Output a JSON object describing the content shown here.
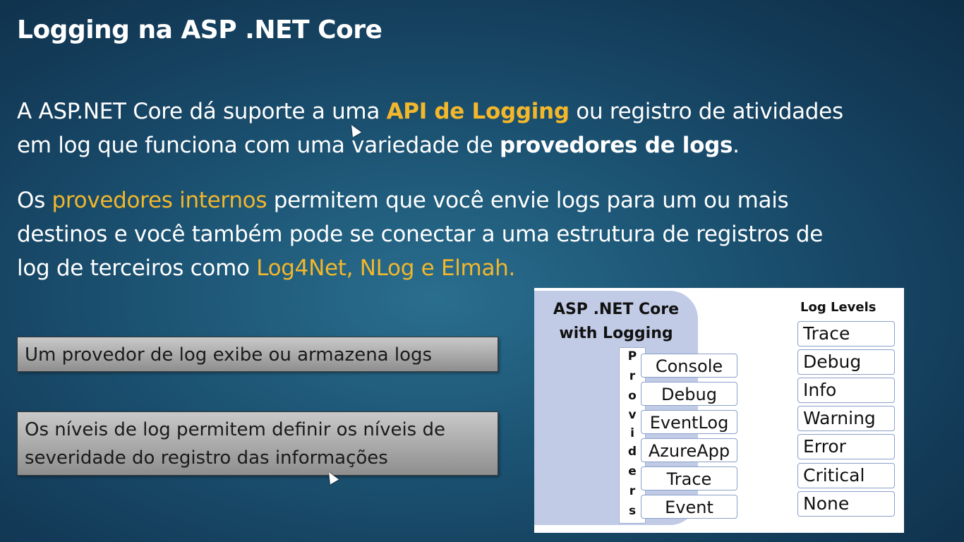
{
  "slide": {
    "title": "Logging na ASP .NET Core",
    "p1": {
      "a": "A ASP.NET Core dá suporte a uma ",
      "b": "API de Logging",
      "c": " ou registro de atividades",
      "d": "em log que funciona com uma variedade de ",
      "e": "provedores de logs",
      "f": "."
    },
    "p2": {
      "a": "Os ",
      "b": "provedores internos",
      "c": " permitem que você envie logs para um ou mais",
      "d": "destinos e você também pode se conectar a uma estrutura de registros de",
      "e": "log de terceiros como ",
      "f": "Log4Net, NLog e Elmah."
    },
    "box1": "Um provedor de log exibe ou armazena logs",
    "box2": {
      "line1": "Os níveis de log permitem definir os níveis de",
      "line2": "severidade do registro das informações"
    },
    "accent_color": "#f2b72b"
  },
  "diagram": {
    "core_line1": "ASP .NET Core",
    "core_line2": "with Logging",
    "providers_letters": [
      "P",
      "r",
      "o",
      "v",
      "i",
      "d",
      "e",
      "r",
      "s"
    ],
    "providers": [
      "Console",
      "Debug",
      "EventLog",
      "AzureApp",
      "Trace",
      "Event"
    ],
    "levels_title": "Log Levels",
    "levels": [
      "Trace",
      "Debug",
      "Info",
      "Warning",
      "Error",
      "Critical",
      "None"
    ]
  }
}
